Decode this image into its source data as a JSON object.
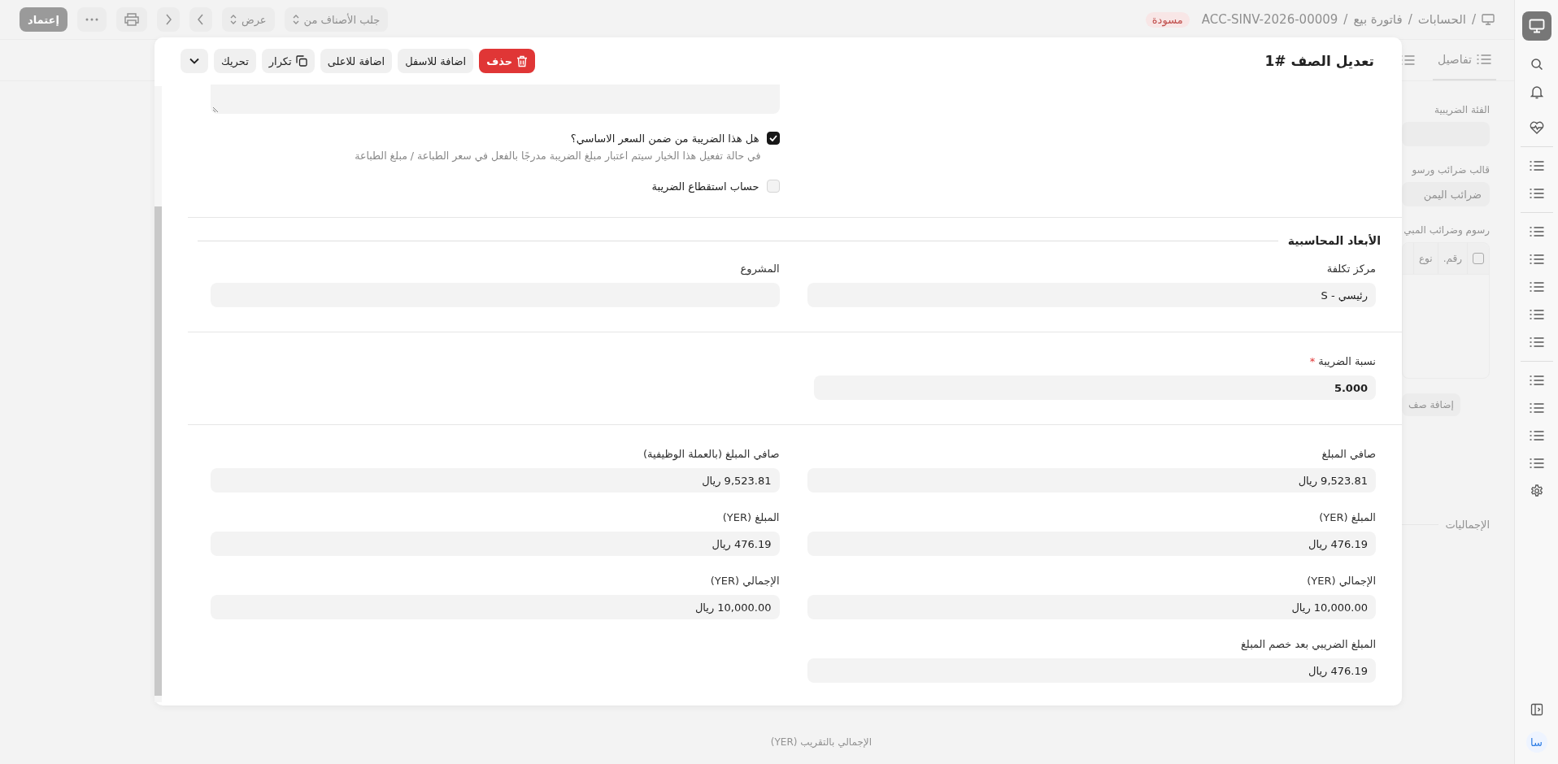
{
  "top_bar": {
    "separator": "/",
    "breadcrumbs": [
      "الحسابات",
      "فاتورة بيع",
      "ACC-SINV-2026-00009"
    ],
    "status": "مسودة",
    "dropdowns": [
      "جلب الأصناف من",
      "عرض"
    ],
    "submit_button": "إعتماد"
  },
  "background_form": {
    "tabs": [
      {
        "label": "تفاصيل",
        "selected": true
      }
    ],
    "fields": [
      {
        "label": "الفئة الضريبية"
      },
      {
        "label": "قالب ضرائب ورسو",
        "value": "ضرائب اليمن"
      }
    ],
    "table": {
      "title": "رسوم وضرائب المبي",
      "select_all_checked": false,
      "columns": [
        "رقم.",
        "نوع"
      ],
      "add_row_button": "إضافة صف"
    },
    "totals_heading": "الإجماليات",
    "rounded_total_label": "الإجمالي بالتقريب (YER)"
  },
  "sidebar": {
    "avatar": "سا"
  },
  "modal": {
    "title": "تعديل الصف #1",
    "actions": [
      {
        "kind": "danger",
        "label": "حذف"
      },
      {
        "kind": "plain",
        "label": "اضافة للاسفل"
      },
      {
        "kind": "plain",
        "label": "اضافة للاعلى"
      },
      {
        "kind": "copy",
        "label": "تكرار"
      },
      {
        "kind": "plain",
        "label": "تحريك"
      },
      {
        "kind": "menu"
      }
    ],
    "checkboxes": [
      {
        "label": "هل هذا الضريبة من ضمن السعر الاساسي؟",
        "checked": true,
        "description": "في حالة تفعيل هذا الخيار سيتم اعتبار مبلغ الضريبة مدرجًا بالفعل في سعر الطباعة / مبلغ الطباعة"
      },
      {
        "label": "حساب استقطاع الضريبة",
        "checked": false
      }
    ],
    "sections": [
      {
        "heading": "الأبعاد المحاسبية",
        "fields": [
          {
            "label": "مركز تكلفة",
            "value": "رئيسي - S"
          },
          {
            "label": "المشروع"
          }
        ]
      },
      {
        "fields": [
          {
            "label": "نسبة الضريبة",
            "required_mark": "*",
            "value": "5.000",
            "bold": true
          }
        ]
      },
      {
        "fields": [
          {
            "label": "صافي المبلغ",
            "value": "9,523.81 ريال"
          },
          {
            "label": "صافي المبلغ (بالعملة الوظيفية)",
            "value": "9,523.81 ريال"
          },
          {
            "label": "المبلغ (YER)",
            "value": "476.19 ريال"
          },
          {
            "label": "المبلغ (YER)",
            "value": "476.19 ريال"
          },
          {
            "label": "الإجمالي (YER)",
            "value": "10,000.00 ريال"
          },
          {
            "label": "الإجمالي (YER)",
            "value": "10,000.00 ريال"
          },
          {
            "label": "المبلغ الضريبي بعد خصم المبلغ",
            "value": "476.19 ريال"
          }
        ]
      }
    ]
  }
}
